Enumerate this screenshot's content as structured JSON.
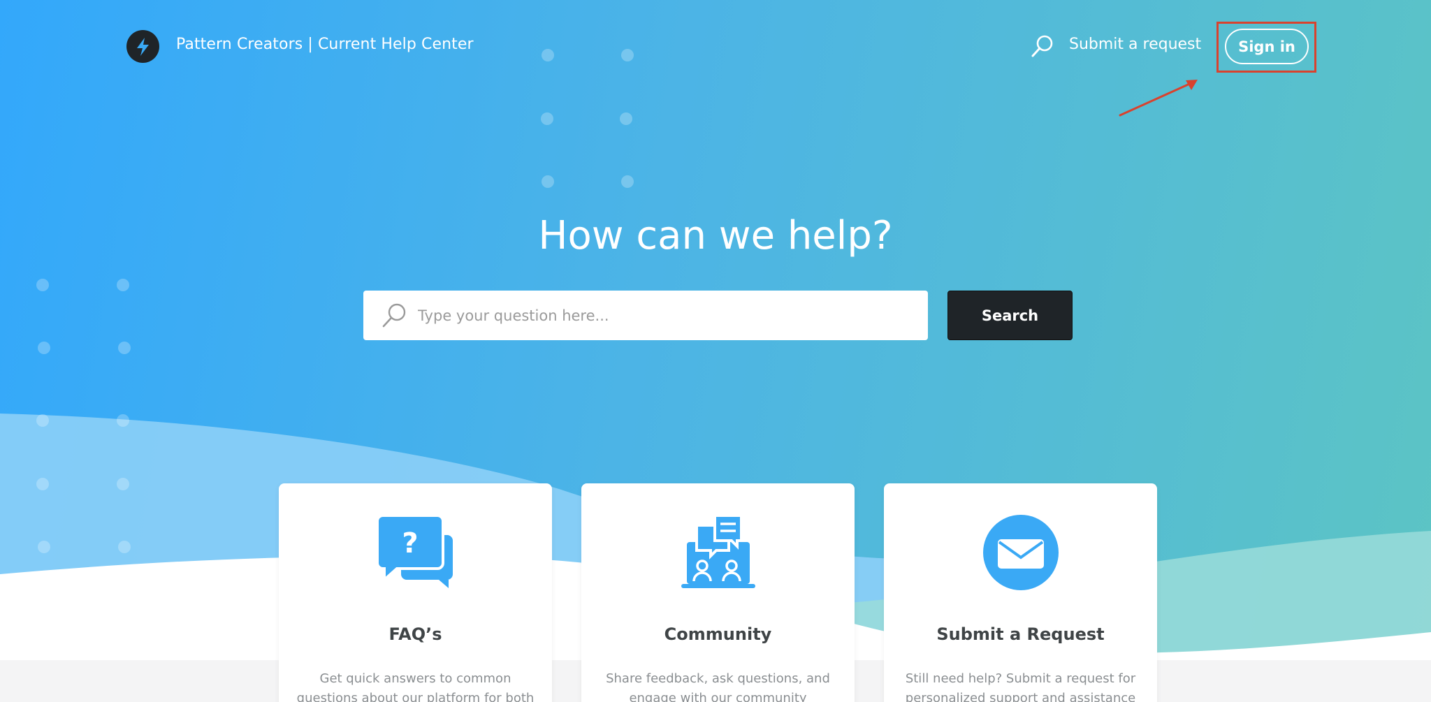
{
  "header": {
    "brand": "Pattern Creators | Current Help Center",
    "submit_request": "Submit a request",
    "sign_in": "Sign in"
  },
  "hero": {
    "title": "How can we help?",
    "search_placeholder": "Type your question here...",
    "search_button": "Search"
  },
  "cards": [
    {
      "title": "FAQ’s",
      "description": "Get quick answers to common questions about our platform for both creators",
      "icon": "faq-chat-question-icon"
    },
    {
      "title": "Community",
      "description": "Share feedback, ask questions, and engage with our community",
      "icon": "community-laptop-icon"
    },
    {
      "title": "Submit a Request",
      "description": "Still need help? Submit a request for personalized support and assistance",
      "icon": "envelope-icon"
    }
  ],
  "colors": {
    "gradient_start": "#33a8fb",
    "gradient_end": "#5cc4c4",
    "accent_blue": "#3aa9f5",
    "dark_button": "#1f2428",
    "annotation_red": "#d9422e"
  }
}
